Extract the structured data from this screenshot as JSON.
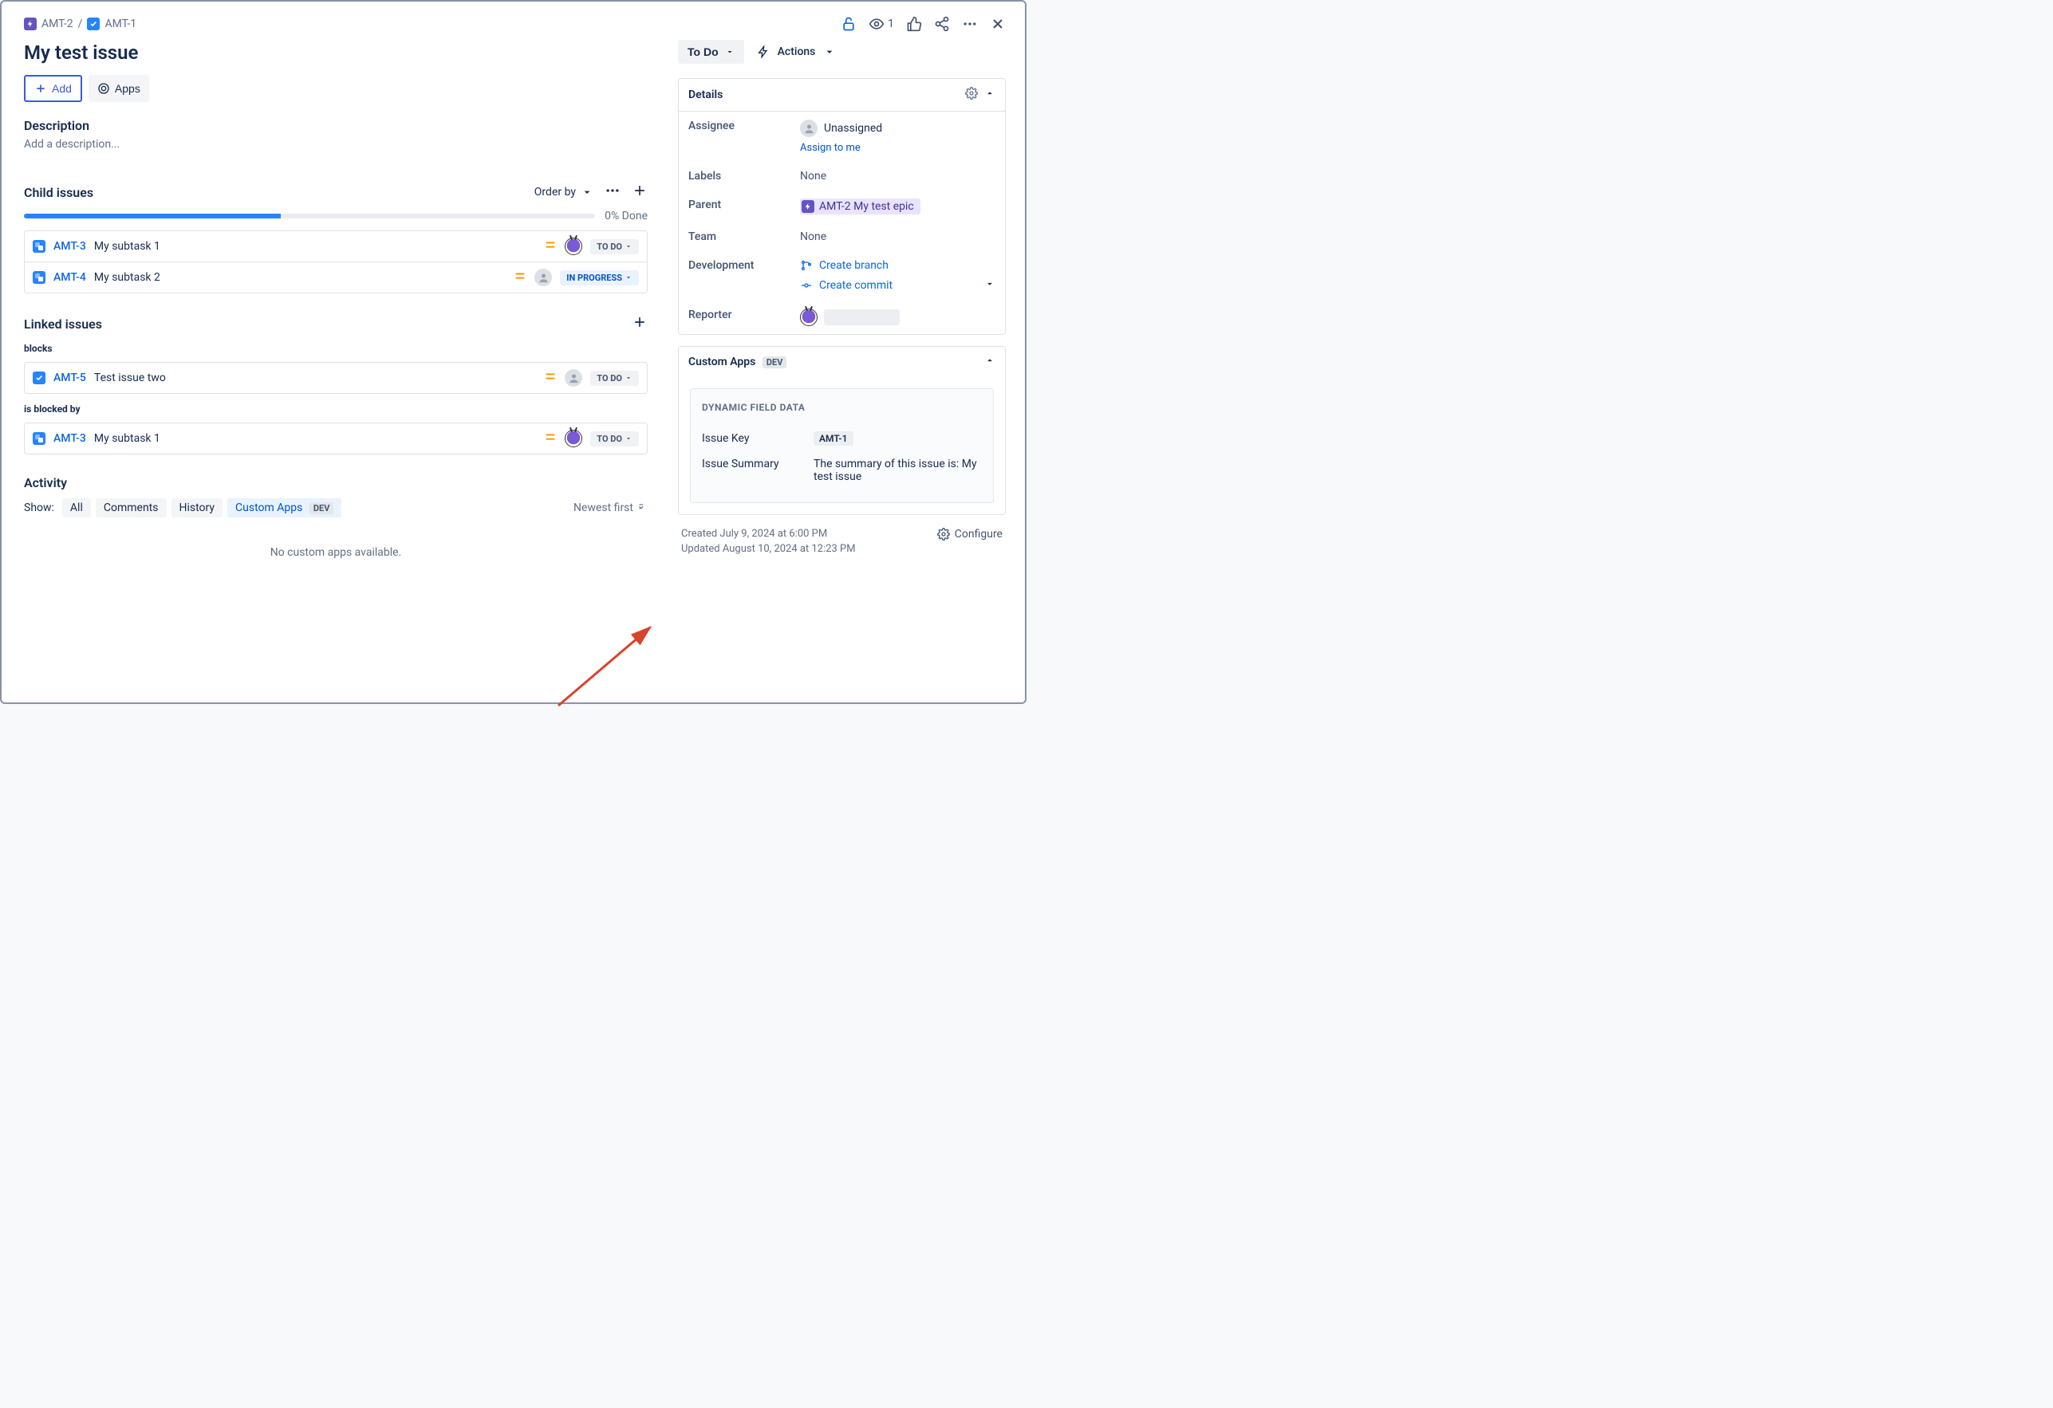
{
  "breadcrumb": {
    "parent_key": "AMT-2",
    "current_key": "AMT-1"
  },
  "watch_count": "1",
  "title": "My test issue",
  "buttons": {
    "add": "Add",
    "apps": "Apps"
  },
  "description": {
    "heading": "Description",
    "placeholder": "Add a description..."
  },
  "child_issues": {
    "heading": "Child issues",
    "order_by": "Order by",
    "done_text": "0% Done",
    "progress_pct": 45,
    "items": [
      {
        "key": "AMT-3",
        "summary": "My subtask 1",
        "status": "TO DO",
        "status_class": "",
        "avatar": "bug"
      },
      {
        "key": "AMT-4",
        "summary": "My subtask 2",
        "status": "IN PROGRESS",
        "status_class": "status-inprogress",
        "avatar": "user"
      }
    ]
  },
  "linked": {
    "heading": "Linked issues",
    "groups": [
      {
        "relation": "blocks",
        "items": [
          {
            "key": "AMT-5",
            "summary": "Test issue two",
            "status": "TO DO",
            "avatar": "user"
          }
        ]
      },
      {
        "relation": "is blocked by",
        "items": [
          {
            "key": "AMT-3",
            "summary": "My subtask 1",
            "status": "TO DO",
            "avatar": "bug"
          }
        ]
      }
    ]
  },
  "activity": {
    "heading": "Activity",
    "show_label": "Show:",
    "tabs": {
      "all": "All",
      "comments": "Comments",
      "history": "History",
      "custom": "Custom Apps"
    },
    "dev_badge": "DEV",
    "newest": "Newest first",
    "empty": "No custom apps available."
  },
  "side": {
    "status": "To Do",
    "actions": "Actions",
    "details_heading": "Details",
    "fields": {
      "assignee_label": "Assignee",
      "unassigned": "Unassigned",
      "assign_to_me": "Assign to me",
      "labels_label": "Labels",
      "labels_value": "None",
      "parent_label": "Parent",
      "parent_value": "AMT-2 My test epic",
      "team_label": "Team",
      "team_value": "None",
      "dev_label": "Development",
      "create_branch": "Create branch",
      "create_commit": "Create commit",
      "reporter_label": "Reporter"
    },
    "custom": {
      "heading": "Custom Apps",
      "dev_badge": "DEV",
      "inner_heading": "DYNAMIC FIELD DATA",
      "key_label": "Issue Key",
      "key_value": "AMT-1",
      "summary_label": "Issue Summary",
      "summary_value": "The summary of this issue is: My test issue"
    },
    "meta": {
      "created": "Created July 9, 2024 at 6:00 PM",
      "updated": "Updated August 10, 2024 at 12:23 PM",
      "configure": "Configure"
    }
  }
}
